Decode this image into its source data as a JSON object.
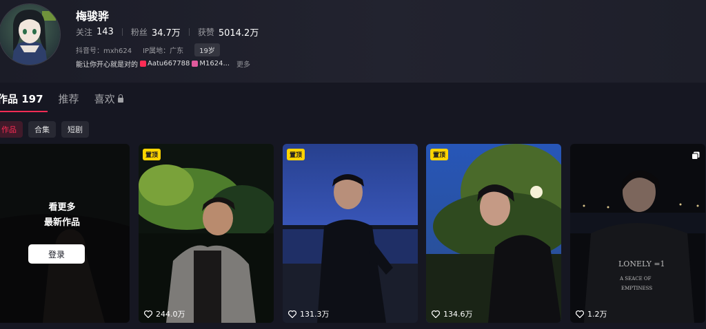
{
  "profile": {
    "name": "梅骏骅",
    "stats": [
      {
        "label": "关注",
        "value": "143"
      },
      {
        "label": "粉丝",
        "value": "34.7万"
      },
      {
        "label": "获赞",
        "value": "5014.2万"
      }
    ],
    "douyin_id": "抖音号：mxh624",
    "ip": "IP属地：广东",
    "age": "19岁",
    "bio_text": "能让你开心就是对的",
    "mention_1": "Aatu667788",
    "mention_2": "M1624...",
    "more": "更多"
  },
  "tabs": [
    {
      "label": "作品 197",
      "active": true
    },
    {
      "label": "推荐",
      "active": false
    },
    {
      "label": "喜欢",
      "active": false
    }
  ],
  "chips": [
    {
      "label": "作品",
      "active": true
    },
    {
      "label": "合集",
      "active": false
    },
    {
      "label": "短剧",
      "active": false
    }
  ],
  "login_card": {
    "line1": "看更多",
    "line2": "最新作品",
    "button": "登录"
  },
  "videos": [
    {
      "pinned_label": "置顶",
      "likes": "244.0万"
    },
    {
      "pinned_label": "置顶",
      "likes": "131.3万"
    },
    {
      "pinned_label": "置顶",
      "likes": "134.6万"
    },
    {
      "pinned_label": "",
      "likes": "1.2万"
    }
  ],
  "colors": {
    "accent": "#fe2c55",
    "pin": "#ffd400",
    "background": "#161722"
  }
}
